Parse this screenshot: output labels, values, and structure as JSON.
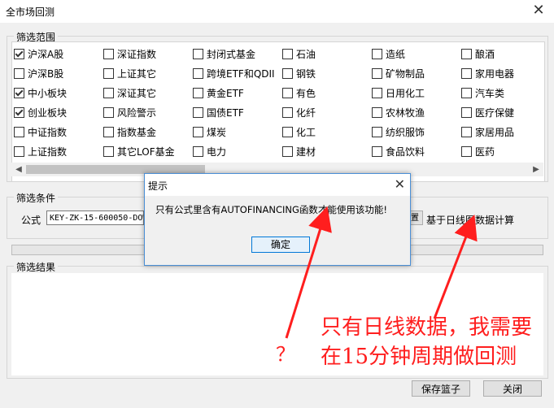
{
  "window": {
    "title": "全市场回测",
    "close_glyph": "✕"
  },
  "scope": {
    "label": "筛选范围",
    "rows": [
      [
        {
          "label": "沪深A股",
          "checked": true
        },
        {
          "label": "深证指数",
          "checked": false
        },
        {
          "label": "封闭式基金",
          "checked": false
        },
        {
          "label": "石油",
          "checked": false
        },
        {
          "label": "造纸",
          "checked": false
        },
        {
          "label": "酿酒",
          "checked": false
        }
      ],
      [
        {
          "label": "沪深B股",
          "checked": false
        },
        {
          "label": "上证其它",
          "checked": false
        },
        {
          "label": "跨境ETF和QDII",
          "checked": false
        },
        {
          "label": "钢铁",
          "checked": false
        },
        {
          "label": "矿物制品",
          "checked": false
        },
        {
          "label": "家用电器",
          "checked": false
        }
      ],
      [
        {
          "label": "中小板块",
          "checked": true
        },
        {
          "label": "深证其它",
          "checked": false
        },
        {
          "label": "黄金ETF",
          "checked": false
        },
        {
          "label": "有色",
          "checked": false
        },
        {
          "label": "日用化工",
          "checked": false
        },
        {
          "label": "汽车类",
          "checked": false
        }
      ],
      [
        {
          "label": "创业板块",
          "checked": true
        },
        {
          "label": "风险警示",
          "checked": false
        },
        {
          "label": "国债ETF",
          "checked": false
        },
        {
          "label": "化纤",
          "checked": false
        },
        {
          "label": "农林牧渔",
          "checked": false
        },
        {
          "label": "医疗保健",
          "checked": false
        }
      ],
      [
        {
          "label": "中证指数",
          "checked": false
        },
        {
          "label": "指数基金",
          "checked": false
        },
        {
          "label": "煤炭",
          "checked": false
        },
        {
          "label": "化工",
          "checked": false
        },
        {
          "label": "纺织服饰",
          "checked": false
        },
        {
          "label": "家居用品",
          "checked": false
        }
      ],
      [
        {
          "label": "上证指数",
          "checked": false
        },
        {
          "label": "其它LOF基金",
          "checked": false
        },
        {
          "label": "电力",
          "checked": false
        },
        {
          "label": "建材",
          "checked": false
        },
        {
          "label": "食品饮料",
          "checked": false
        },
        {
          "label": "医药",
          "checked": false
        }
      ]
    ]
  },
  "conditions": {
    "label": "筛选条件",
    "formula_label": "公式",
    "formula_value": "KEY-ZK-15-600050-DOW",
    "formula_btn": "置",
    "calc_note": "基于日线图数据计算"
  },
  "results": {
    "label": "筛选结果"
  },
  "buttons": {
    "save": "保存篮子",
    "close": "关闭"
  },
  "dialog": {
    "title": "提示",
    "message": "只有公式里含有AUTOFINANCING函数才能使用该功能!",
    "ok": "确定",
    "close_glyph": "✕"
  },
  "annotation": {
    "line1": "只有日线数据，我需要",
    "line2": "在15分钟周期做回测",
    "question": "？",
    "color": "#ff1e1e"
  }
}
